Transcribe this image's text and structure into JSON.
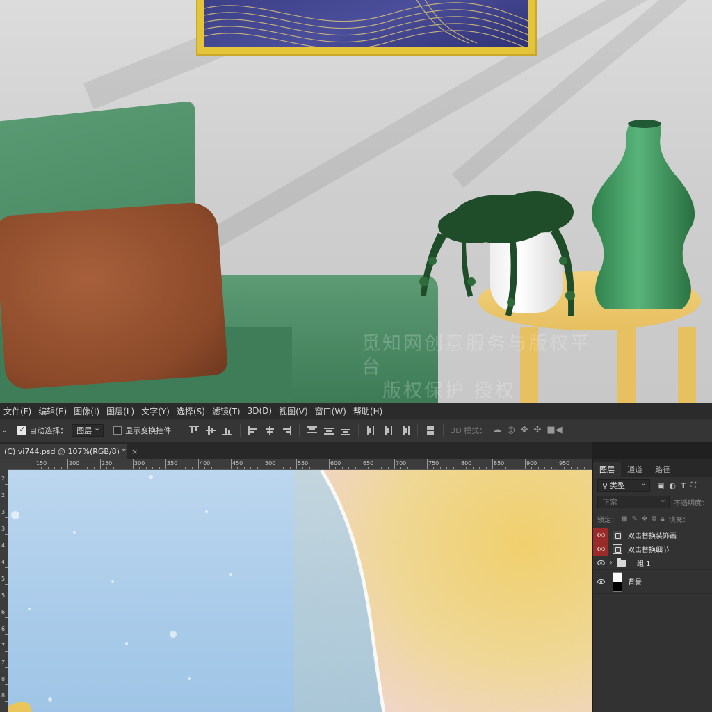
{
  "mockup": {
    "watermark_lines": [
      "觅知网创意服务与版权平台",
      "版权保护 授权"
    ],
    "colors": {
      "wall": "#d3d3d3",
      "frame": "#e4c43a",
      "art": "#3f4390",
      "sofa": "#4a8a63",
      "pillow": "#9a5533",
      "table": "#efcb70",
      "vase": "#3f9a5e"
    }
  },
  "menu": [
    "文件(F)",
    "编辑(E)",
    "图像(I)",
    "图层(L)",
    "文字(Y)",
    "选择(S)",
    "滤镜(T)",
    "3D(D)",
    "视图(V)",
    "窗口(W)",
    "帮助(H)"
  ],
  "options": {
    "auto_select_label": "自动选择：",
    "auto_select_value": "图层",
    "show_transform_label": "显示变换控件",
    "mode_3d_label": "3D 模式："
  },
  "document": {
    "tab_title": "(C) vi744.psd @ 107%(RGB/8) *",
    "close": "×"
  },
  "ruler": {
    "h_labels": [
      "150",
      "200",
      "250",
      "300",
      "350",
      "400",
      "450",
      "500",
      "550",
      "600",
      "650",
      "700",
      "750",
      "800",
      "850",
      "900",
      "950"
    ],
    "v_labels": [
      "2",
      "2",
      "3",
      "3",
      "4",
      "4",
      "5",
      "5",
      "6",
      "6",
      "7",
      "7",
      "8",
      "8"
    ]
  },
  "layers_panel": {
    "tabs": [
      "图层",
      "通道",
      "路径"
    ],
    "filter": "类型",
    "blend_mode": "正常",
    "opacity_label": "不透明度：",
    "lock_label": "锁定：",
    "fill_label": "填充：",
    "layers": [
      {
        "name": "双击替换装饰画",
        "kind": "smart",
        "marked": true
      },
      {
        "name": "双击替换细节",
        "kind": "smart",
        "marked": true
      },
      {
        "name": "组 1",
        "kind": "group",
        "marked": false
      },
      {
        "name": "背景",
        "kind": "background",
        "marked": false
      }
    ]
  }
}
